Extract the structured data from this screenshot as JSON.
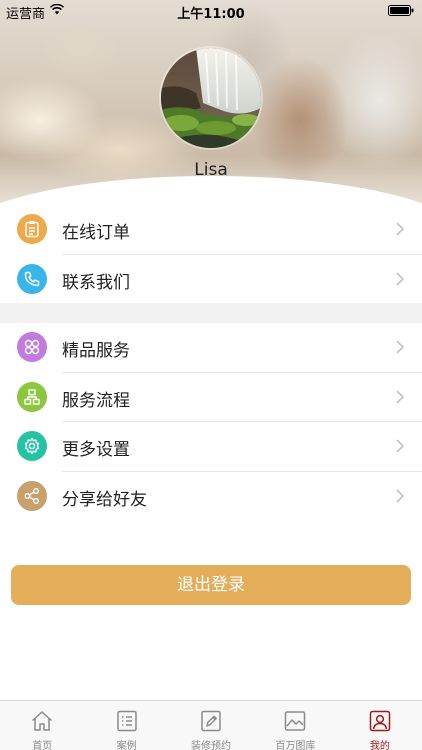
{
  "status_bar": {
    "carrier": "运营商",
    "time": "上午11:00"
  },
  "profile": {
    "username": "Lisa",
    "avatar_icon": "waterfall-photo-avatar"
  },
  "menu_groups": [
    {
      "items": [
        {
          "label": "在线订单",
          "icon": "clipboard-icon",
          "color": "#f0a94a"
        },
        {
          "label": "联系我们",
          "icon": "phone-icon",
          "color": "#3ab5ea"
        }
      ]
    },
    {
      "items": [
        {
          "label": "精品服务",
          "icon": "grid-flower-icon",
          "color": "#c07ae0"
        },
        {
          "label": "服务流程",
          "icon": "flowchart-icon",
          "color": "#8cc63f"
        },
        {
          "label": "更多设置",
          "icon": "gear-icon",
          "color": "#25c3a3"
        },
        {
          "label": "分享给好友",
          "icon": "share-icon",
          "color": "#c9a06a"
        }
      ]
    }
  ],
  "logout_label": "退出登录",
  "colors": {
    "logout": "#e3ad5a",
    "tab_active": "#a11a1a",
    "tab_inactive": "#8a8a8a"
  },
  "tabs": [
    {
      "label": "首页",
      "icon": "house-icon"
    },
    {
      "label": "案例",
      "icon": "list-icon"
    },
    {
      "label": "装修预约",
      "icon": "pencil-icon"
    },
    {
      "label": "百万图库",
      "icon": "picture-icon"
    },
    {
      "label": "我的",
      "icon": "user-icon",
      "active": true
    }
  ]
}
